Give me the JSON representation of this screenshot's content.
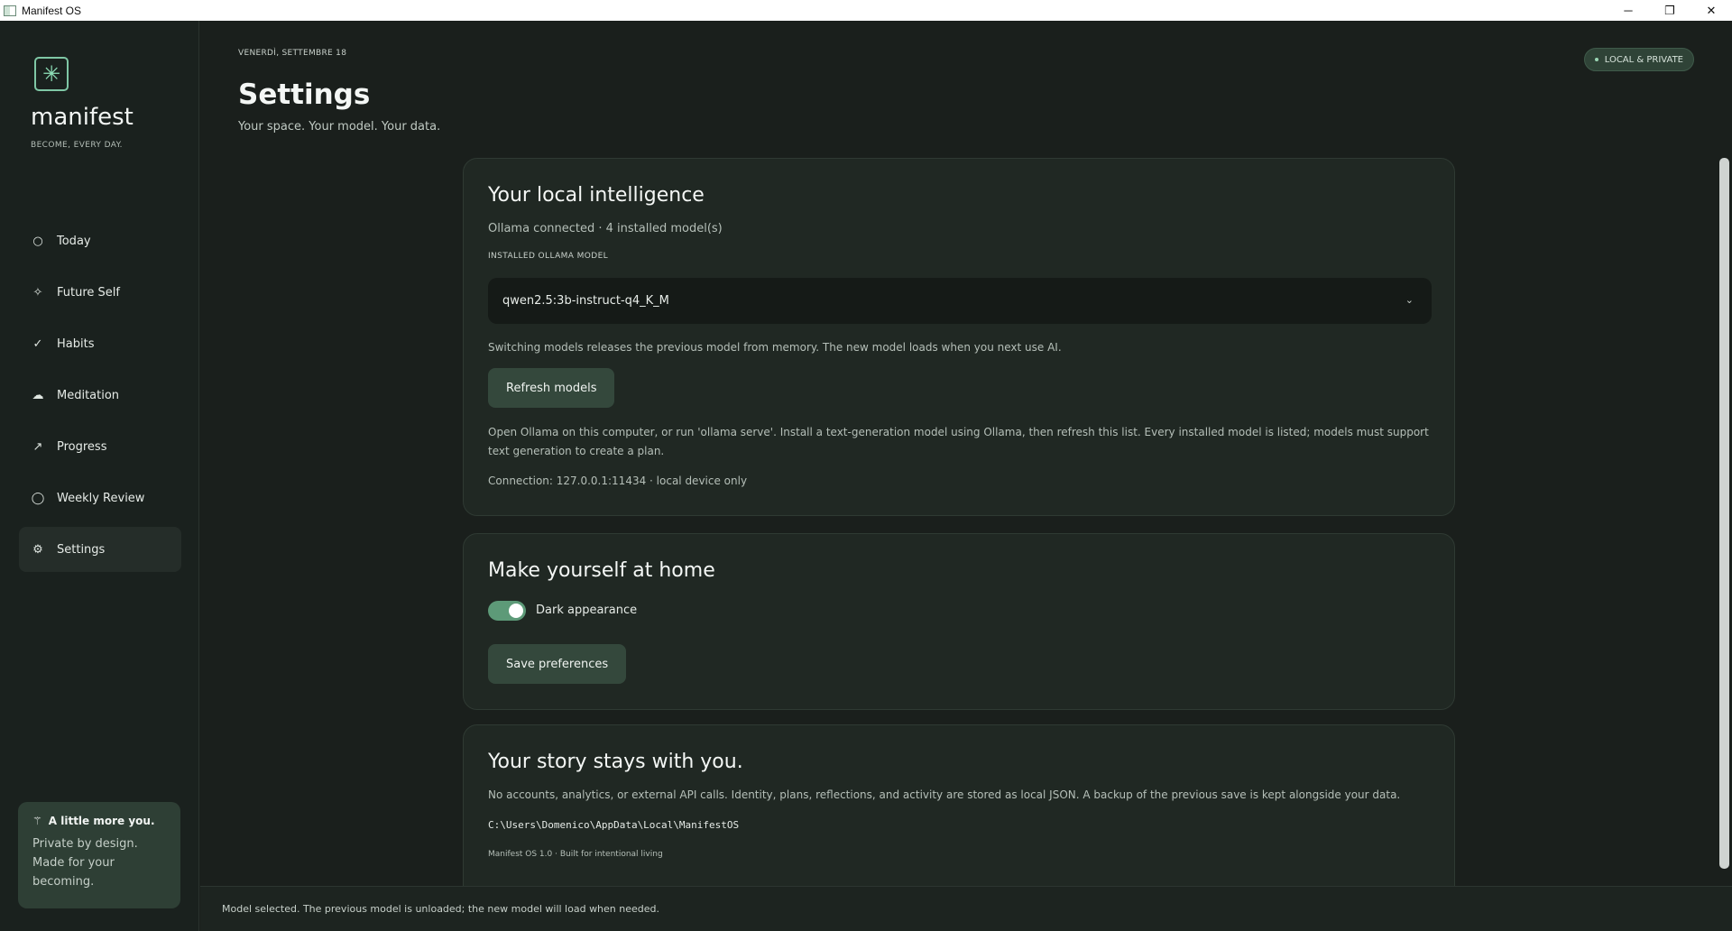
{
  "window": {
    "title": "Manifest OS",
    "minimize": "─",
    "maximize": "❐",
    "close": "✕"
  },
  "sidebar": {
    "brand": "manifest",
    "tagline": "BECOME, EVERY DAY.",
    "logo_icon": "✳",
    "items": [
      {
        "label": "Today",
        "icon": "○"
      },
      {
        "label": "Future Self",
        "icon": "✧"
      },
      {
        "label": "Habits",
        "icon": "✓"
      },
      {
        "label": "Meditation",
        "icon": "☁"
      },
      {
        "label": "Progress",
        "icon": "↗"
      },
      {
        "label": "Weekly Review",
        "icon": "◯"
      },
      {
        "label": "Settings",
        "icon": "⚙"
      }
    ],
    "active_item": "Settings",
    "card": {
      "icon": "⚚",
      "title": "A little more you.",
      "body": "Private by design. Made for your becoming."
    }
  },
  "header": {
    "date": "VENERDÌ, SETTEMBRE 18",
    "title": "Settings",
    "subtitle": "Your space. Your model. Your data.",
    "badge": "LOCAL & PRIVATE"
  },
  "intelligence": {
    "title": "Your local intelligence",
    "status": "Ollama connected · 4 installed model(s)",
    "model_label": "INSTALLED OLLAMA MODEL",
    "selected_model": "qwen2.5:3b-instruct-q4_K_M",
    "chevron": "⌄",
    "switch_note": "Switching models releases the previous model from memory. The new model loads when you next use AI.",
    "refresh_label": "Refresh models",
    "help_text": "Open Ollama on this computer, or run 'ollama serve'. Install a text-generation model using Ollama, then refresh this list. Every installed model is listed; models must support text generation to create a plan.",
    "connection": "Connection: 127.0.0.1:11434 · local device only"
  },
  "appearance": {
    "title": "Make yourself at home",
    "dark_label": "Dark appearance",
    "dark_enabled": true,
    "save_label": "Save preferences"
  },
  "story": {
    "title": "Your story stays with you.",
    "body": "No accounts, analytics, or external API calls. Identity, plans, reflections, and activity are stored as local JSON. A backup of the previous save is kept alongside your data.",
    "path": "C:\\Users\\Domenico\\AppData\\Local\\ManifestOS",
    "version": "Manifest OS 1.0 · Built for intentional living"
  },
  "status_bar": "Model selected. The previous model is unloaded; the new model will load when needed.",
  "colors": {
    "accent": "#5d9a78",
    "button": "#34483c",
    "background": "#1a1f1c",
    "card": "#202823"
  }
}
